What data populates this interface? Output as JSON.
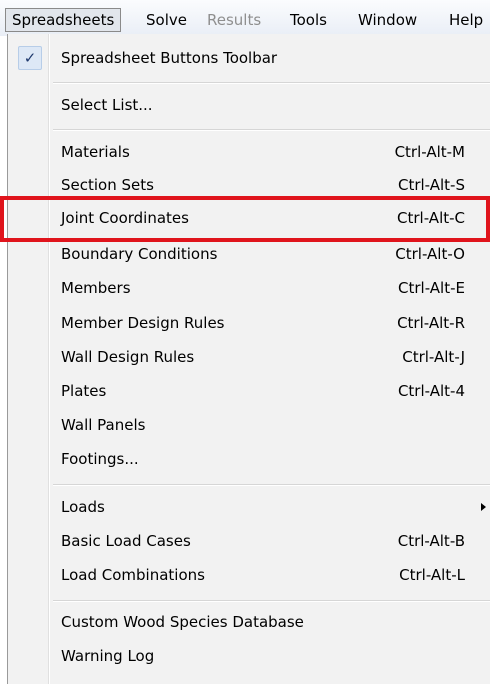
{
  "menubar": {
    "spreadsheets": "Spreadsheets",
    "solve": "Solve",
    "results": "Results",
    "tools": "Tools",
    "window": "Window",
    "help": "Help"
  },
  "menu": {
    "toolbar_check": "✓",
    "spreadsheet_buttons_toolbar": "Spreadsheet Buttons Toolbar",
    "select_list": "Select List...",
    "materials": {
      "label": "Materials",
      "shortcut": "Ctrl-Alt-M"
    },
    "section_sets": {
      "label": "Section Sets",
      "shortcut": "Ctrl-Alt-S"
    },
    "joint_coordinates": {
      "label": "Joint Coordinates",
      "shortcut": "Ctrl-Alt-C"
    },
    "boundary_conditions": {
      "label": "Boundary Conditions",
      "shortcut": "Ctrl-Alt-O"
    },
    "members": {
      "label": "Members",
      "shortcut": "Ctrl-Alt-E"
    },
    "member_design_rules": {
      "label": "Member Design Rules",
      "shortcut": "Ctrl-Alt-R"
    },
    "wall_design_rules": {
      "label": "Wall Design Rules",
      "shortcut": "Ctrl-Alt-J"
    },
    "plates": {
      "label": "Plates",
      "shortcut": "Ctrl-Alt-4"
    },
    "wall_panels": "Wall Panels",
    "footings": "Footings...",
    "loads": "Loads",
    "basic_load_cases": {
      "label": "Basic Load Cases",
      "shortcut": "Ctrl-Alt-B"
    },
    "load_combinations": {
      "label": "Load Combinations",
      "shortcut": "Ctrl-Alt-L"
    },
    "custom_wood_species_database": "Custom Wood Species Database",
    "warning_log": "Warning Log"
  },
  "colors": {
    "highlight_border": "#e0141c",
    "menu_background": "#f2f2f2",
    "disabled_text": "#8f8f8f"
  }
}
